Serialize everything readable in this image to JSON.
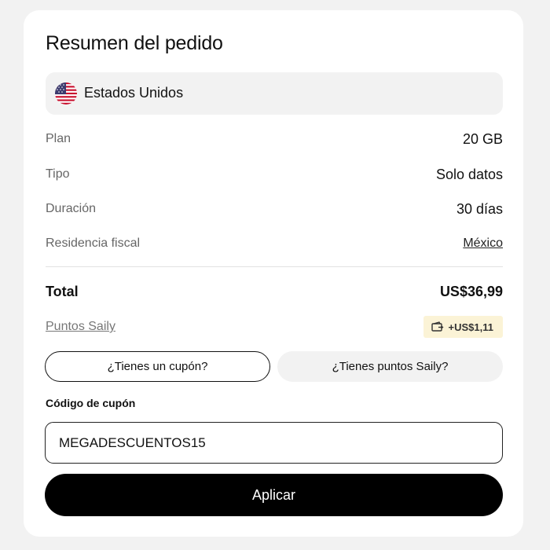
{
  "summary": {
    "title": "Resumen del pedido",
    "country": {
      "name": "Estados Unidos",
      "flag_icon": "us-flag-icon"
    },
    "details": [
      {
        "label": "Plan",
        "value": "20 GB"
      },
      {
        "label": "Tipo",
        "value": "Solo datos"
      },
      {
        "label": "Duración",
        "value": "30 días"
      },
      {
        "label": "Residencia fiscal",
        "value": "México"
      }
    ],
    "total": {
      "label": "Total",
      "value": "US$36,99"
    },
    "points": {
      "label": "Puntos Saily",
      "badge": "+US$1,11",
      "badge_icon": "wallet-icon"
    }
  },
  "tabs": [
    {
      "label": "¿Tienes un cupón?",
      "active": true
    },
    {
      "label": "¿Tienes puntos Saily?",
      "active": false
    }
  ],
  "coupon": {
    "label": "Código de cupón",
    "value": "MEGADESCUENTOS15"
  },
  "apply_label": "Aplicar",
  "colors": {
    "page_bg": "#f2f2f2",
    "card_bg": "#ffffff",
    "button_bg": "#000000",
    "badge_bg": "#fbf3d6"
  }
}
